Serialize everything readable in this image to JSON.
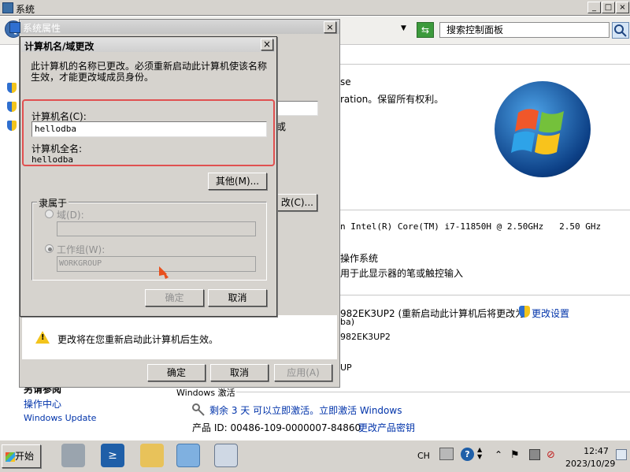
{
  "system_window": {
    "title": "系统",
    "minimize": "_",
    "maximize": "□",
    "close": "×",
    "search_placeholder": "搜索控制面板"
  },
  "right_pane": {
    "copyright_1": "se",
    "copyright_2": "ration。保留所有权利。",
    "processor": "n Intel(R) Core(TM) i7-11850H @ 2.50GHz   2.50 GHz",
    "os_type": "操作系统",
    "pen_touch": "用于此显示器的笔或触控输入",
    "computer_name": "982EK3UP2 (重新启动此计算机后将更改为",
    "change_settings": "更改设置",
    "name_suffix": "ba)",
    "full_name": "982EK3UP2",
    "workgroup": "UP"
  },
  "left_pane": {
    "see_also": "另请参阅",
    "action_center": "操作中心",
    "windows_update": "Windows Update"
  },
  "activation": {
    "header": "Windows 激活",
    "status": "剩余 3 天 可以立即激活。立即激活 Windows",
    "product_id": "产品 ID: 00486-109-0000007-84860",
    "change_key": "更改产品密钥"
  },
  "props_dialog": {
    "title": "系统属性",
    "close": "×",
    "warning": "更改将在您重新启动此计算机后生效。",
    "ok": "确定",
    "cancel": "取消",
    "apply": "应用(A)",
    "partial_text_1": "或",
    "partial_change_button": "改(C)..."
  },
  "name_dialog": {
    "title": "计算机名/域更改",
    "close": "×",
    "description": "此计算机的名称已更改。必须重新启动此计算机使该名称生效，才能更改域成员身份。",
    "computer_name_label": "计算机名(C):",
    "computer_name_value": "hellodba",
    "full_name_label": "计算机全名:",
    "full_name_value": "hellodba",
    "more_button": "其他(M)...",
    "member_of": "隶属于",
    "domain_label": "域(D):",
    "domain_value": "",
    "workgroup_label": "工作组(W):",
    "workgroup_value": "WORKGROUP",
    "ok": "确定",
    "cancel": "取消"
  },
  "taskbar": {
    "start": "开始",
    "lang": "CH",
    "time": "12:47",
    "date": "2023/10/29"
  }
}
